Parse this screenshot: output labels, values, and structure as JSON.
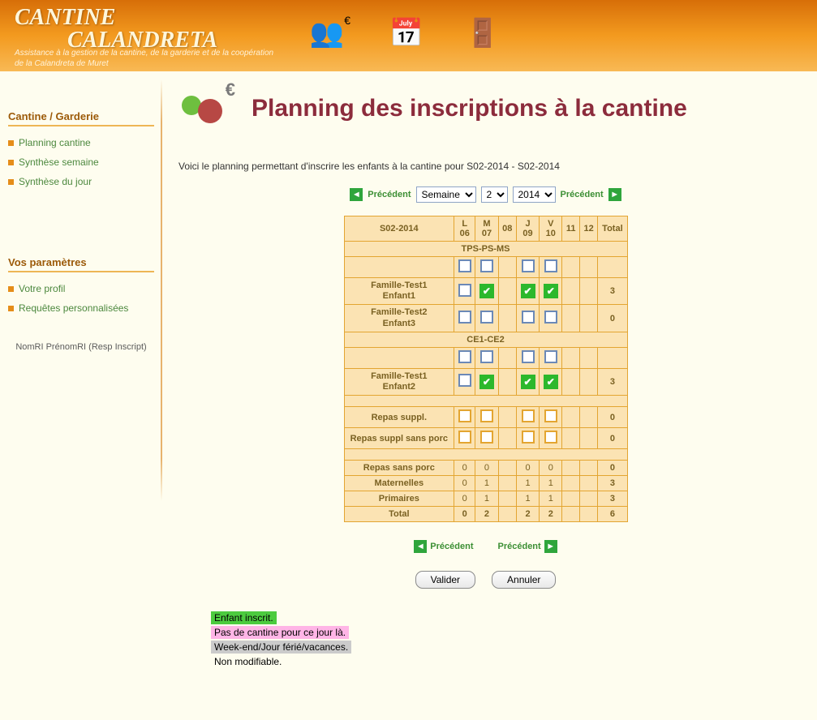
{
  "app": {
    "title1": "CANTINE",
    "title2": "CALANDRETA",
    "subtitle": "Assistance à la gestion de la cantine, de la garderie et de la coopération de la Calandreta de Muret"
  },
  "sidebar": {
    "sec1_title": "Cantine / Garderie",
    "items1": [
      "Planning cantine",
      "Synthèse semaine",
      "Synthèse du jour"
    ],
    "sec2_title": "Vos paramètres",
    "items2": [
      "Votre profil",
      "Requêtes personnalisées"
    ],
    "user": "NomRI PrénomRI (Resp Inscript)"
  },
  "page": {
    "title": "Planning des inscriptions à la cantine",
    "intro": "Voici le planning permettant d'inscrire les enfants à la cantine pour S02-2014 - S02-2014",
    "pager_prev": "Précédent",
    "pager_next": "Précédent",
    "sel_period": "Semaine",
    "sel_week": "2",
    "sel_year": "2014"
  },
  "table": {
    "week_label": "S02-2014",
    "days": [
      {
        "d": "L",
        "n": "06"
      },
      {
        "d": "M",
        "n": "07"
      },
      {
        "d": "",
        "n": "08"
      },
      {
        "d": "J",
        "n": "09"
      },
      {
        "d": "V",
        "n": "10"
      },
      {
        "d": "",
        "n": "11"
      },
      {
        "d": "",
        "n": "12"
      }
    ],
    "total_label": "Total",
    "classes": [
      {
        "name": "TPS-PS-MS",
        "rows": [
          {
            "name1": "Famille-Test1",
            "name2": "Enfant1",
            "cells": [
              "e",
              "g",
              "p",
              "g",
              "g",
              "x",
              "x"
            ],
            "total": "3"
          },
          {
            "name1": "Famille-Test2",
            "name2": "Enfant3",
            "cells": [
              "e",
              "e",
              "p",
              "e",
              "e",
              "x",
              "x"
            ],
            "total": "0"
          }
        ]
      },
      {
        "name": "CE1-CE2",
        "rows": [
          {
            "name1": "Famille-Test1",
            "name2": "Enfant2",
            "cells": [
              "e",
              "g",
              "p",
              "g",
              "g",
              "x",
              "x"
            ],
            "total": "3"
          }
        ]
      }
    ],
    "suppl_rows": [
      {
        "label": "Repas suppl.",
        "cells": [
          "o",
          "o",
          "-",
          "o",
          "o",
          "-",
          "-"
        ],
        "total": "0"
      },
      {
        "label": "Repas suppl sans porc",
        "cells": [
          "o",
          "o",
          "-",
          "o",
          "o",
          "-",
          "-"
        ],
        "total": "0"
      }
    ],
    "count_rows": [
      {
        "label": "Repas sans porc",
        "v": [
          "0",
          "0",
          "",
          "0",
          "0",
          "",
          ""
        ],
        "total": "0"
      },
      {
        "label": "Maternelles",
        "v": [
          "0",
          "1",
          "",
          "1",
          "1",
          "",
          ""
        ],
        "total": "3"
      },
      {
        "label": "Primaires",
        "v": [
          "0",
          "1",
          "",
          "1",
          "1",
          "",
          ""
        ],
        "total": "3"
      }
    ],
    "grand": {
      "label": "Total",
      "v": [
        "0",
        "2",
        "",
        "2",
        "2",
        "",
        ""
      ],
      "total": "6"
    }
  },
  "buttons": {
    "ok": "Valider",
    "cancel": "Annuler"
  },
  "legend": {
    "g": "Enfant inscrit.",
    "p": "Pas de cantine pour ce jour là.",
    "x": "Week-end/Jour férié/vacances.",
    "n": "Non modifiable."
  }
}
